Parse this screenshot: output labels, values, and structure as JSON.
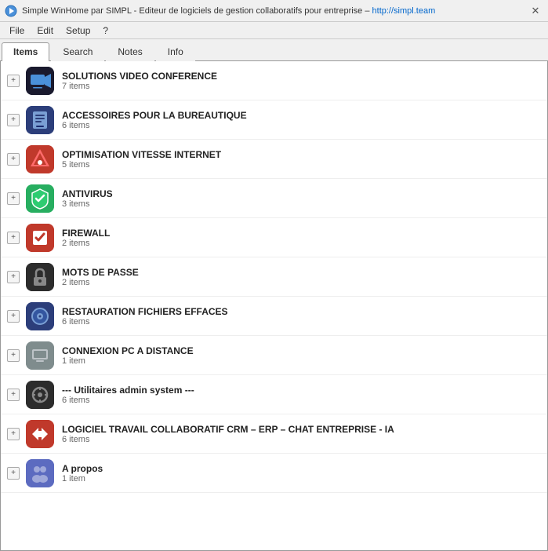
{
  "window": {
    "title": "Simple WinHome par SIMPL - Editeur de logiciels de gestion collaboratifs pour entreprise – ",
    "url": "http://simpl.team",
    "close_label": "✕"
  },
  "menu": {
    "items": [
      {
        "label": "File",
        "id": "file"
      },
      {
        "label": "Edit",
        "id": "edit"
      },
      {
        "label": "Setup",
        "id": "setup"
      },
      {
        "label": "?",
        "id": "help"
      }
    ]
  },
  "tabs": [
    {
      "label": "Items",
      "id": "items",
      "active": true
    },
    {
      "label": "Search",
      "id": "search",
      "active": false
    },
    {
      "label": "Notes",
      "id": "notes",
      "active": false
    },
    {
      "label": "Info",
      "id": "info",
      "active": false
    }
  ],
  "items": [
    {
      "id": "video",
      "title": "SOLUTIONS VIDEO CONFERENCE",
      "count": "7 items",
      "icon_class": "icon-video",
      "icon_emoji": "🖥"
    },
    {
      "id": "office",
      "title": "ACCESSOIRES POUR LA BUREAUTIQUE",
      "count": "6 items",
      "icon_class": "icon-office",
      "icon_emoji": "💾"
    },
    {
      "id": "internet",
      "title": "OPTIMISATION VITESSE INTERNET",
      "count": "5 items",
      "icon_class": "icon-internet",
      "icon_emoji": "🚀"
    },
    {
      "id": "antivirus",
      "title": "ANTIVIRUS",
      "count": "3 items",
      "icon_class": "icon-antivirus",
      "icon_emoji": "🛡"
    },
    {
      "id": "firewall",
      "title": "FIREWALL",
      "count": "2 items",
      "icon_class": "icon-firewall",
      "icon_emoji": "✔"
    },
    {
      "id": "password",
      "title": "MOTS DE PASSE",
      "count": "2 items",
      "icon_class": "icon-password",
      "icon_emoji": "★"
    },
    {
      "id": "restore",
      "title": "RESTAURATION FICHIERS EFFACES",
      "count": "6 items",
      "icon_class": "icon-restore",
      "icon_emoji": "💿"
    },
    {
      "id": "remote",
      "title": "CONNEXION PC A DISTANCE",
      "count": "1 item",
      "icon_class": "icon-remote",
      "icon_emoji": "🔌"
    },
    {
      "id": "admin",
      "title": "--- Utilitaires admin system ---",
      "count": "6 items",
      "icon_class": "icon-admin",
      "icon_emoji": "⚙"
    },
    {
      "id": "crm",
      "title": "LOGICIEL TRAVAIL COLLABORATIF CRM – ERP – CHAT ENTREPRISE - IA",
      "count": "6 items",
      "icon_class": "icon-crm",
      "icon_emoji": "↔"
    },
    {
      "id": "about",
      "title": "A propos",
      "count": "1 item",
      "icon_class": "icon-about",
      "icon_emoji": "👥"
    }
  ],
  "expand_label": "+"
}
